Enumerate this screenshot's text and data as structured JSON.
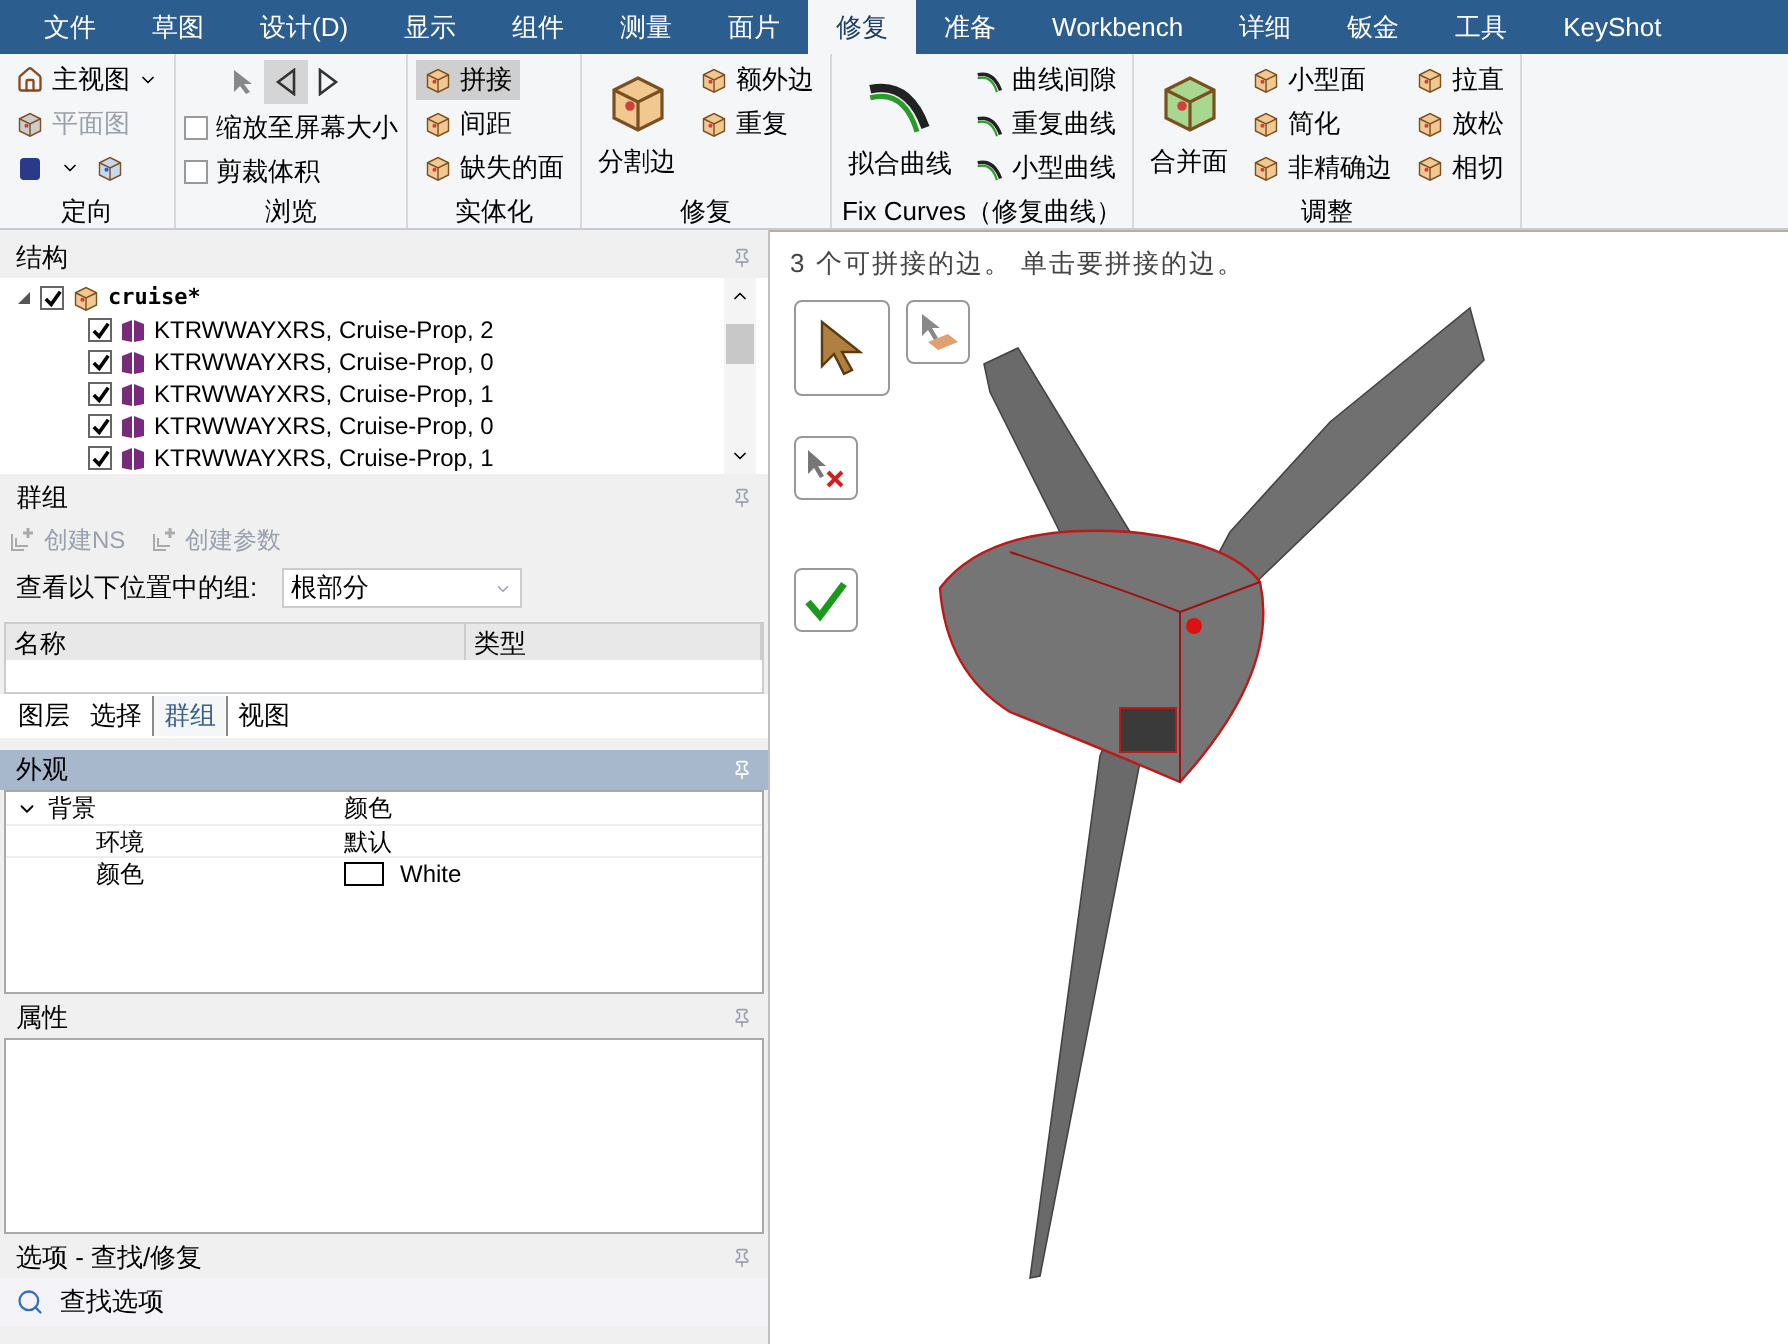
{
  "menu_tabs": [
    {
      "label": "文件",
      "selected": false
    },
    {
      "label": "草图",
      "selected": false
    },
    {
      "label": "设计(D)",
      "selected": false
    },
    {
      "label": "显示",
      "selected": false
    },
    {
      "label": "组件",
      "selected": false
    },
    {
      "label": "测量",
      "selected": false
    },
    {
      "label": "面片",
      "selected": false
    },
    {
      "label": "修复",
      "selected": true
    },
    {
      "label": "准备",
      "selected": false
    },
    {
      "label": "Workbench",
      "selected": false
    },
    {
      "label": "详细",
      "selected": false
    },
    {
      "label": "钣金",
      "selected": false
    },
    {
      "label": "工具",
      "selected": false
    },
    {
      "label": "KeyShot",
      "selected": false
    }
  ],
  "ribbon": {
    "groups": [
      {
        "title": "定向",
        "columns": [
          [
            {
              "kind": "dropdown",
              "label": "主视图"
            },
            {
              "kind": "button",
              "label": "平面图",
              "disabled": true
            },
            {
              "kind": "icon-row"
            }
          ]
        ]
      },
      {
        "title": "浏览",
        "columns": [
          [
            {
              "kind": "nav"
            },
            {
              "kind": "checkbox",
              "label": "缩放至屏幕大小",
              "checked": false
            },
            {
              "kind": "checkbox",
              "label": "剪裁体积",
              "checked": false
            }
          ]
        ]
      },
      {
        "title": "实体化",
        "columns": [
          [
            {
              "kind": "button",
              "label": "拼接",
              "selected": true
            },
            {
              "kind": "button",
              "label": "间距",
              "selected": false
            },
            {
              "kind": "button",
              "label": "缺失的面",
              "selected": false
            }
          ]
        ]
      },
      {
        "title": "修复",
        "columns": [
          [
            {
              "kind": "large",
              "label": "分割边"
            }
          ],
          [
            {
              "kind": "button",
              "label": "额外边",
              "selected": false
            },
            {
              "kind": "button",
              "label": "重复",
              "selected": false
            }
          ]
        ]
      },
      {
        "title": "Fix Curves（修复曲线）",
        "columns": [
          [
            {
              "kind": "large",
              "label": "拟合曲线"
            }
          ],
          [
            {
              "kind": "button",
              "label": "曲线间隙",
              "selected": false
            },
            {
              "kind": "button",
              "label": "重复曲线",
              "selected": false
            },
            {
              "kind": "button",
              "label": "小型曲线",
              "selected": false
            }
          ]
        ]
      },
      {
        "title": "调整",
        "columns": [
          [
            {
              "kind": "large",
              "label": "合并面"
            }
          ],
          [
            {
              "kind": "button",
              "label": "小型面",
              "selected": false
            },
            {
              "kind": "button",
              "label": "简化",
              "selected": false
            },
            {
              "kind": "button",
              "label": "非精确边",
              "selected": false
            }
          ],
          [
            {
              "kind": "button",
              "label": "拉直",
              "selected": false
            },
            {
              "kind": "button",
              "label": "放松",
              "selected": false
            },
            {
              "kind": "button",
              "label": "相切",
              "selected": false
            }
          ]
        ]
      }
    ]
  },
  "structure": {
    "title": "结构",
    "tree": [
      {
        "label": "cruise*",
        "checked": true,
        "expanded": true,
        "children": [
          {
            "label": "KTRWWAYXRS, Cruise-Prop, 2",
            "checked": true
          },
          {
            "label": "KTRWWAYXRS, Cruise-Prop, 0",
            "checked": true
          },
          {
            "label": "KTRWWAYXRS, Cruise-Prop, 1",
            "checked": true
          },
          {
            "label": "KTRWWAYXRS, Cruise-Prop, 0",
            "checked": true
          },
          {
            "label": "KTRWWAYXRS, Cruise-Prop, 1",
            "checked": true
          }
        ]
      }
    ]
  },
  "groups": {
    "title": "群组",
    "actions": [
      {
        "label": "创建NS",
        "disabled": true
      },
      {
        "label": "创建参数",
        "disabled": true
      }
    ],
    "location_label": "查看以下位置中的组:",
    "location_value": "根部分",
    "columns": [
      "名称",
      "类型"
    ],
    "tabs": [
      {
        "label": "图层",
        "selected": false
      },
      {
        "label": "选择",
        "selected": false
      },
      {
        "label": "群组",
        "selected": true
      },
      {
        "label": "视图",
        "selected": false
      }
    ]
  },
  "appearance": {
    "title": "外观",
    "active": true,
    "rows": [
      {
        "name": "背景",
        "value": "颜色",
        "expanded": true,
        "children": [
          {
            "name": "环境",
            "value": "默认"
          },
          {
            "name": "颜色",
            "value": "White",
            "kind": "color"
          }
        ]
      }
    ]
  },
  "properties": {
    "title": "属性",
    "active": false
  },
  "options": {
    "title": "选项 - 查找/修复",
    "active": false,
    "item": "查找选项"
  },
  "viewport": {
    "hint": "3 个可拼接的边。 单击要拼接的边。",
    "tools": [
      {
        "kind": "select",
        "selected": true
      },
      {
        "kind": "select-face",
        "selected": false
      },
      {
        "kind": "exclude",
        "selected": false
      },
      {
        "kind": "complete",
        "selected": false
      }
    ]
  }
}
